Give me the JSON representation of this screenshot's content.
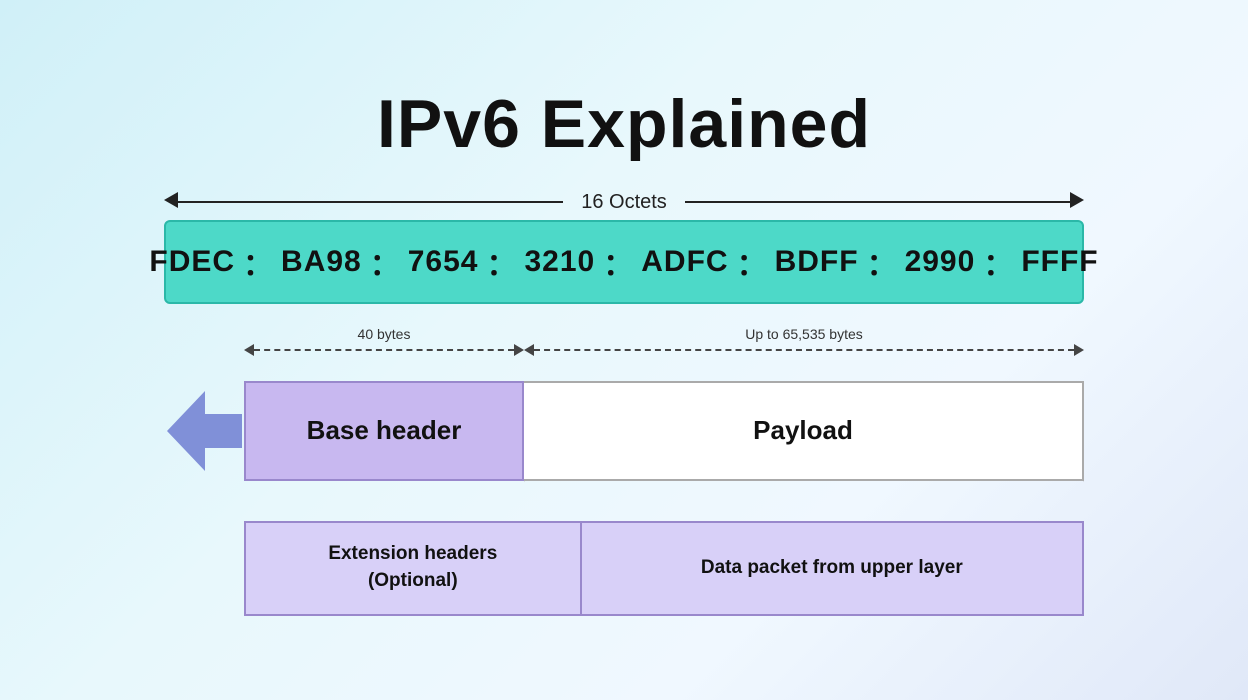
{
  "title": "IPv6 Explained",
  "octets_label": "16 Octets",
  "ipv6_address": {
    "segments": [
      "FDEC",
      "BA98",
      "7654",
      "3210",
      "ADFC",
      "BDFF",
      "2990",
      "FFFF"
    ]
  },
  "annotation_40": "40 bytes",
  "annotation_65535": "Up to 65,535 bytes",
  "base_header_label": "Base header",
  "payload_label": "Payload",
  "extension_headers_label": "Extension headers\n(Optional)",
  "data_packet_label": "Data packet from upper layer",
  "colors": {
    "teal": "#4dd9c8",
    "purple_light": "#c8b8f0",
    "purple_arrow": "#8090d8",
    "expansion": "#d8d0f8",
    "white": "#ffffff"
  }
}
